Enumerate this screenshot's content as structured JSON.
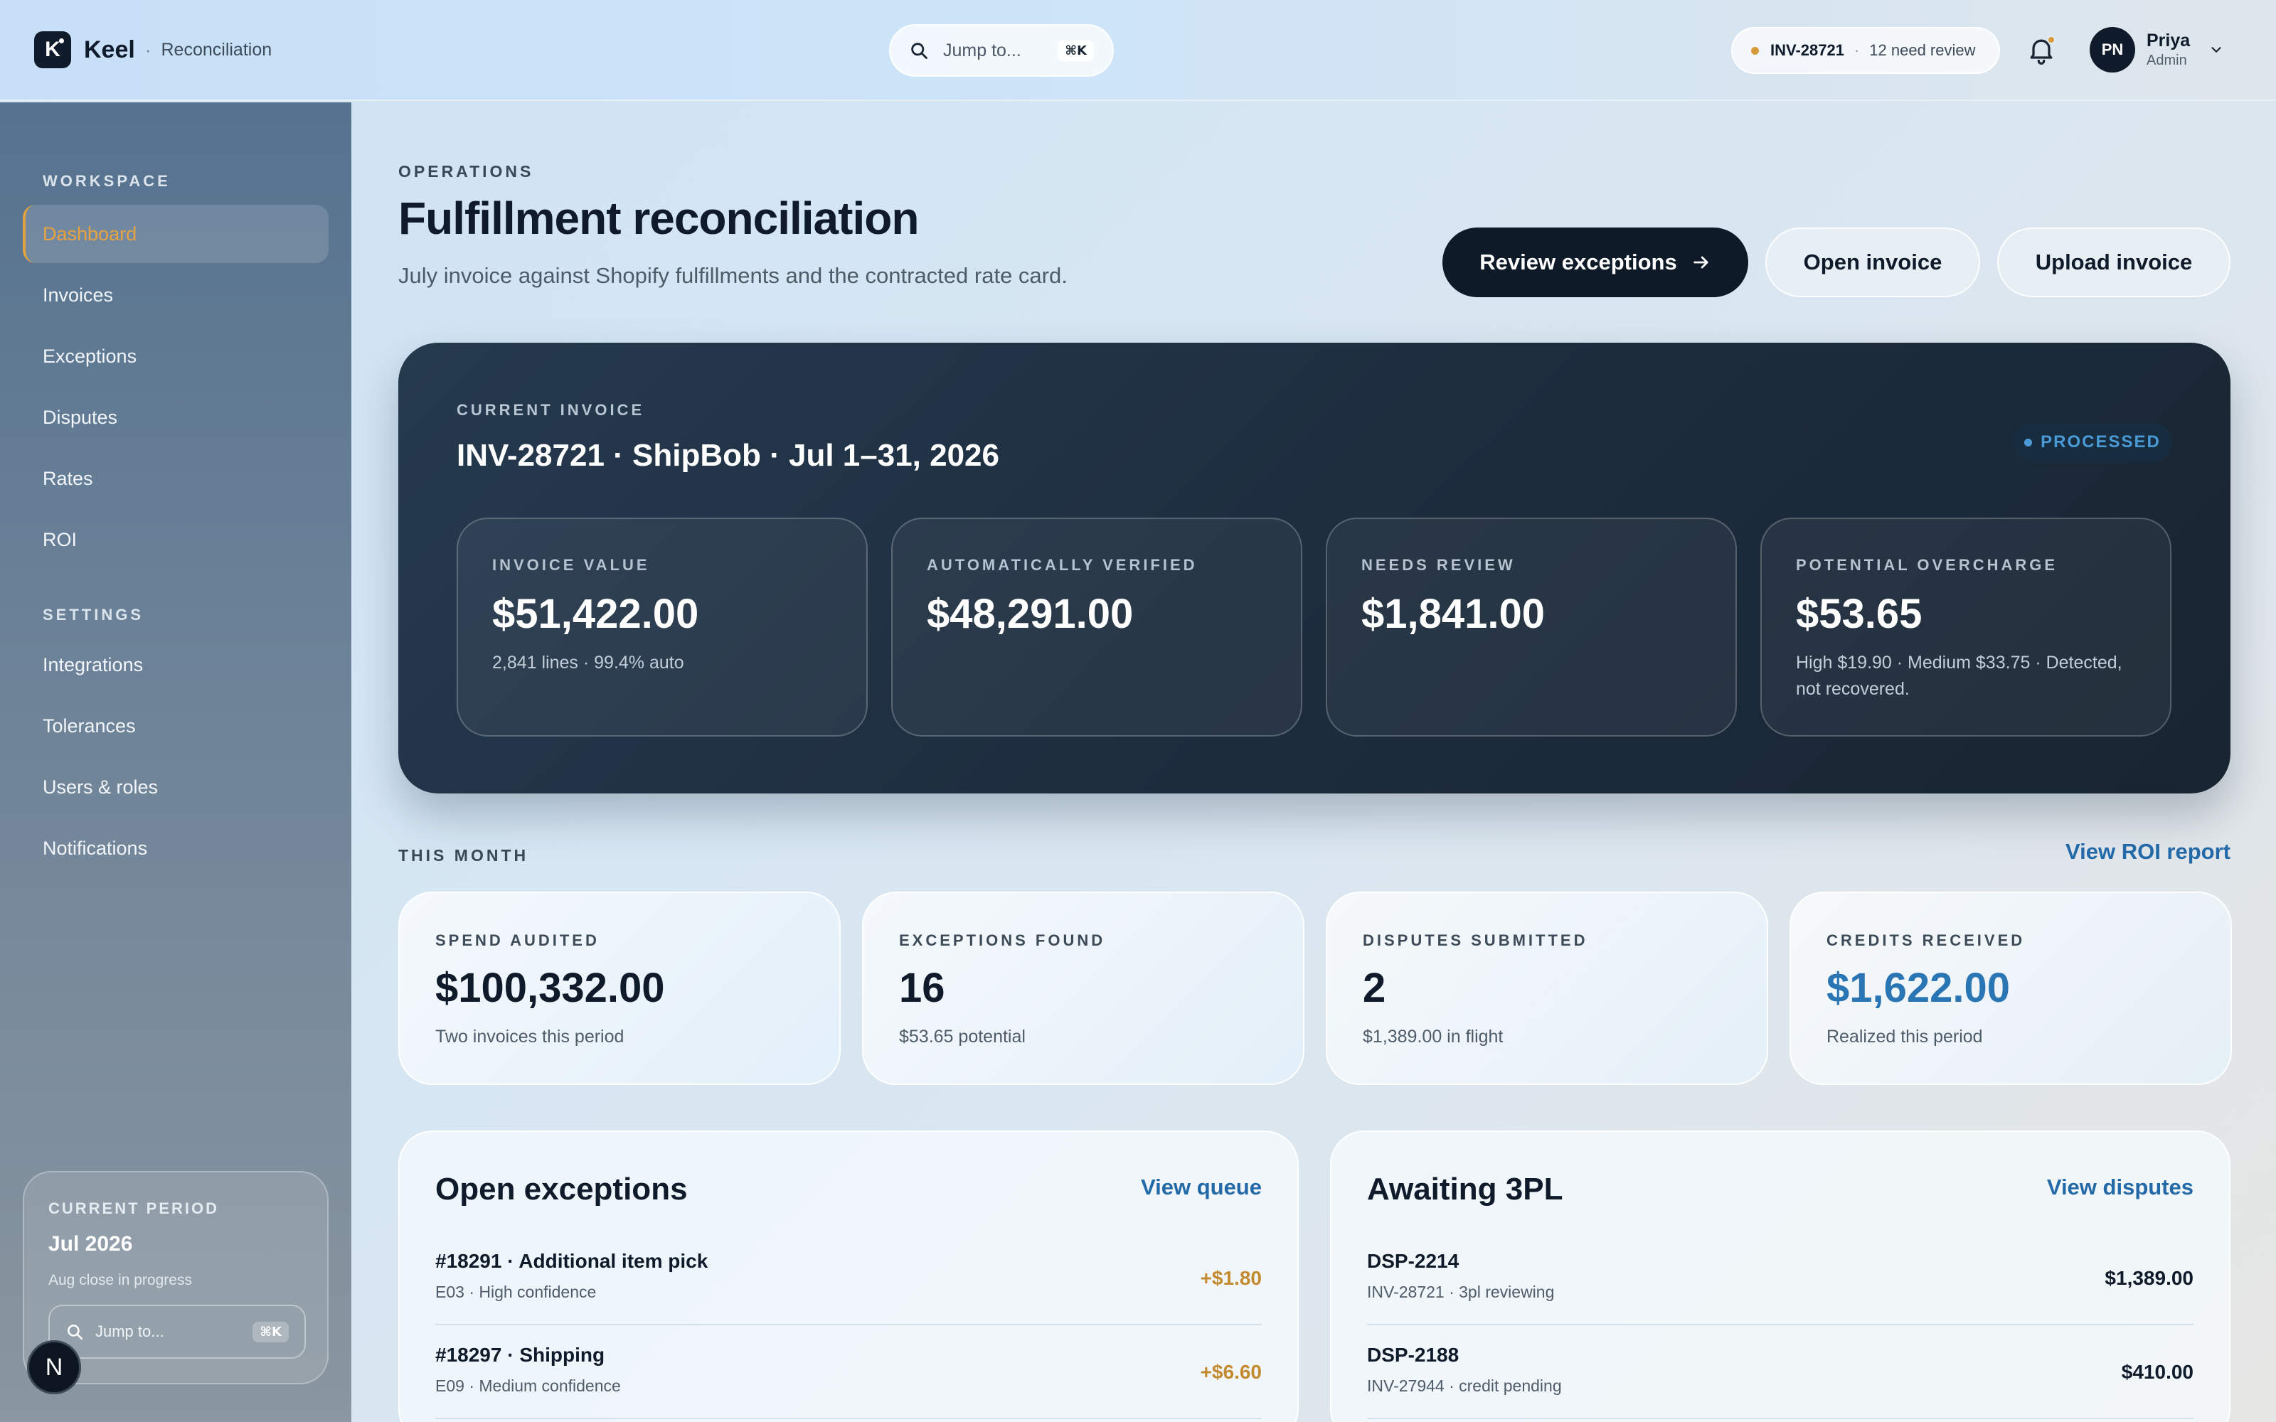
{
  "header": {
    "logo_letter": "K",
    "app_name": "Keel",
    "separator": "·",
    "section": "Reconciliation",
    "search_placeholder": "Jump to...",
    "search_shortcut": "⌘K",
    "invoice_pill": {
      "invoice": "INV-28721",
      "separator": "·",
      "status": "12 need review"
    },
    "user": {
      "initials": "PN",
      "name": "Priya",
      "role": "Admin"
    }
  },
  "sidebar": {
    "workspace_heading": "WORKSPACE",
    "workspace_items": [
      "Dashboard",
      "Invoices",
      "Exceptions",
      "Disputes",
      "Rates",
      "ROI"
    ],
    "settings_heading": "SETTINGS",
    "settings_items": [
      "Integrations",
      "Tolerances",
      "Users & roles",
      "Notifications"
    ],
    "period": {
      "heading": "CURRENT PERIOD",
      "value": "Jul 2026",
      "sub": "Aug close in progress",
      "search_placeholder": "Jump to...",
      "search_shortcut": "⌘K"
    },
    "n_badge": "N"
  },
  "main": {
    "eyebrow": "OPERATIONS",
    "title": "Fulfillment reconciliation",
    "subtitle": "July invoice against Shopify fulfillments and the contracted rate card.",
    "actions": {
      "review": "Review exceptions",
      "open": "Open invoice",
      "upload": "Upload invoice"
    },
    "invoice": {
      "eyebrow": "CURRENT INVOICE",
      "title": "INV-28721 · ShipBob · Jul 1–31, 2026",
      "status": "PROCESSED",
      "stats": [
        {
          "label": "INVOICE VALUE",
          "value": "$51,422.00",
          "sub": "2,841 lines · 99.4% auto"
        },
        {
          "label": "AUTOMATICALLY VERIFIED",
          "value": "$48,291.00",
          "sub": ""
        },
        {
          "label": "NEEDS REVIEW",
          "value": "$1,841.00",
          "sub": ""
        },
        {
          "label": "POTENTIAL OVERCHARGE",
          "value": "$53.65",
          "sub": "High $19.90 · Medium $33.75 · Detected, not recovered."
        }
      ]
    },
    "month": {
      "eyebrow": "THIS MONTH",
      "link": "View ROI report",
      "cards": [
        {
          "label": "SPEND AUDITED",
          "value": "$100,332.00",
          "sub": "Two invoices this period"
        },
        {
          "label": "EXCEPTIONS FOUND",
          "value": "16",
          "sub": "$53.65 potential"
        },
        {
          "label": "DISPUTES SUBMITTED",
          "value": "2",
          "sub": "$1,389.00 in flight"
        },
        {
          "label": "CREDITS RECEIVED",
          "value": "$1,622.00",
          "sub": "Realized this period"
        }
      ]
    },
    "exceptions": {
      "title": "Open exceptions",
      "link": "View queue",
      "rows": [
        {
          "title": "#18291 · Additional item pick",
          "sub": "E03 · High confidence",
          "amount": "+$1.80"
        },
        {
          "title": "#18297 · Shipping",
          "sub": "E09 · Medium confidence",
          "amount": "+$6.60"
        }
      ]
    },
    "awaiting": {
      "title": "Awaiting 3PL",
      "link": "View disputes",
      "rows": [
        {
          "title": "DSP-2214",
          "sub": "INV-28721 · 3pl reviewing",
          "amount": "$1,389.00"
        },
        {
          "title": "DSP-2188",
          "sub": "INV-27944 · credit pending",
          "amount": "$410.00"
        }
      ]
    }
  },
  "colors": {
    "accent_amber": "#d69a3a",
    "link_blue": "#2369a8",
    "dark_navy": "#0e1a27",
    "processed_blue": "#4a9ad6"
  }
}
